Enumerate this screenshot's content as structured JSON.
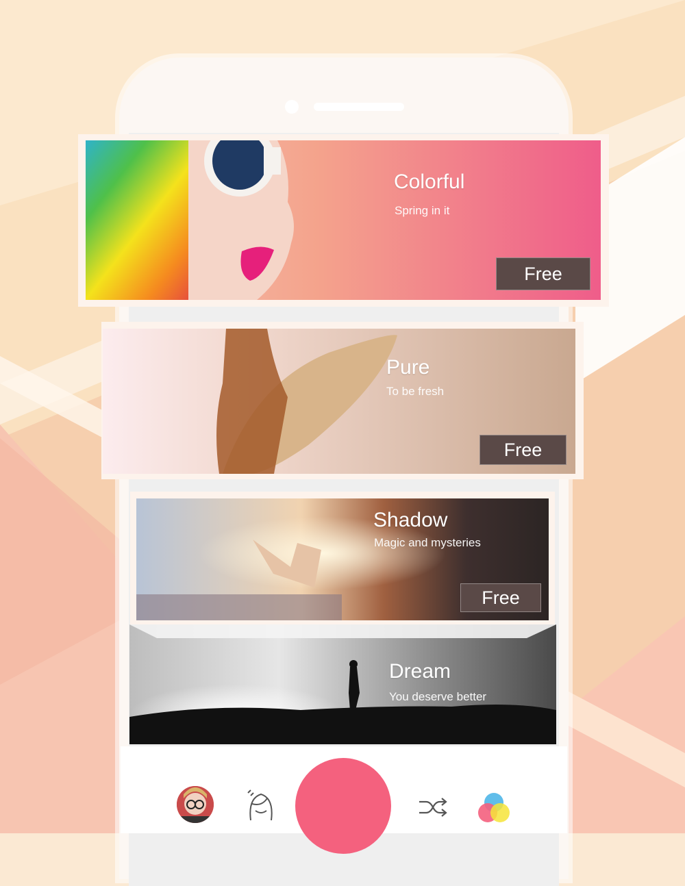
{
  "filters": [
    {
      "title": "Colorful",
      "subtitle": "Spring in it",
      "button": "Free"
    },
    {
      "title": "Pure",
      "subtitle": "To be fresh",
      "button": "Free"
    },
    {
      "title": "Shadow",
      "subtitle": "Magic and mysteries",
      "button": "Free"
    },
    {
      "title": "Dream",
      "subtitle": "You deserve better"
    }
  ],
  "bottom_nav": {
    "items": [
      "avatar",
      "face-icon",
      "shutter-button",
      "shuffle-icon",
      "filters-icon"
    ],
    "accent_color": "#f4617e"
  },
  "colors": {
    "background": "#fbe9d3",
    "free_button": "#5a4947"
  }
}
